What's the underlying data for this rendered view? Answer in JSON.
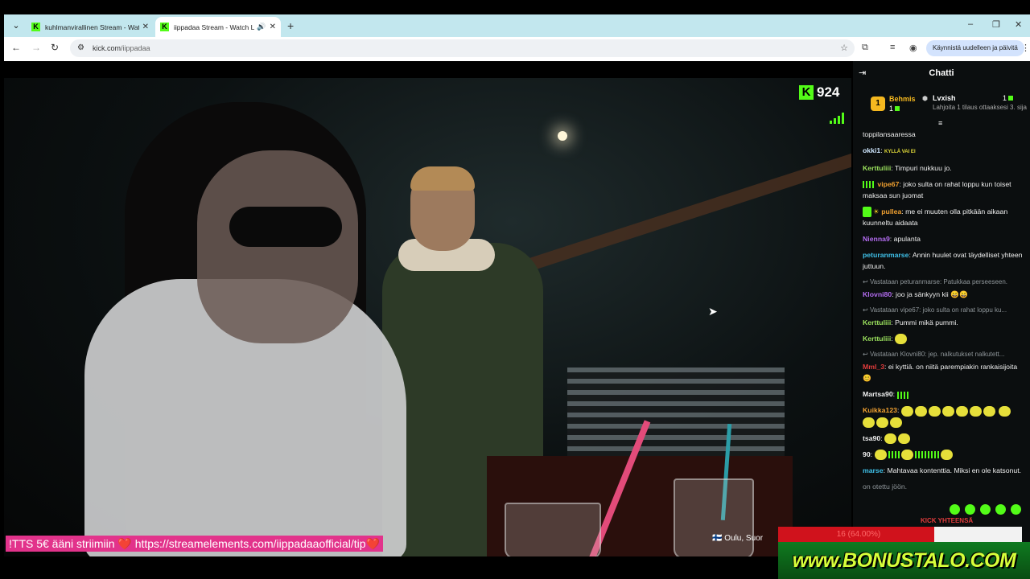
{
  "browser": {
    "tabs": [
      {
        "title": "kuhlmanvirallinen Stream - Wat",
        "active": false
      },
      {
        "title": "iippadaa Stream - Watch Li",
        "active": true
      }
    ],
    "new_tab": "+",
    "url_host": "kick.com",
    "url_path": "/iippadaa",
    "update_button": "Käynnistä uudelleen ja päivitä",
    "window_controls": [
      "–",
      "❐",
      "✕"
    ]
  },
  "stream": {
    "viewer_count": "924",
    "kick_logo": "K",
    "tts_banner": "!TTS 5€ ääni striimiin ❤️ https://streamelements.com/iippadaaofficial/tip❤️",
    "location": "🇫🇮 Oulu, Suor"
  },
  "chat": {
    "header": "Chatti",
    "leaderboard": {
      "first": {
        "rank": "1",
        "name": "Behmis",
        "count": "1"
      },
      "second": {
        "name": "Lvxish",
        "count": "1",
        "note": "Lahjoita 1 tilaus ottaaksesi 3. sija"
      }
    },
    "messages": [
      {
        "user": "",
        "text": "toppilansaaressa",
        "color": "#efefef"
      },
      {
        "user": "okki1",
        "text": "KYLLÄ VAI EI",
        "color": "#cfe7ff"
      },
      {
        "user": "Kerttuliii",
        "text": "Timpuri nukkuu jo.",
        "color": "#9be15d"
      },
      {
        "user": "vipe67",
        "text": "joko sulta on rahat loppu kun toiset maksaa sun juomat",
        "color": "#f0a030"
      },
      {
        "user": "pullea",
        "text": "me ei muuten olla pitkään aikaan kuunneltu aidaata",
        "color": "#f0a030"
      },
      {
        "user": "Nienna9",
        "text": "apulanta",
        "color": "#b36cf0"
      },
      {
        "user": "peturanmarse",
        "text": "Annin huulet ovat täydelliset yhteen juttuun.",
        "color": "#3fc0e8"
      },
      {
        "reply": "Vastataan peturanmarse: Patukkaa perseeseen.",
        "user": "Klovni80",
        "text": "joo ja sänkyyn kii 😄😄",
        "color": "#b36cf0"
      },
      {
        "reply": "Vastataan vipe67: joko sulta on rahat loppu ku...",
        "user": "Kerttuliii",
        "text": "Pummi mikä pummi.",
        "color": "#9be15d"
      },
      {
        "user": "Kerttuliii",
        "text": "",
        "color": "#9be15d"
      },
      {
        "reply": "Vastataan Klovni80: jep. nalkutukset nalkutett...",
        "user": "Mml_3",
        "text": "ei kyttiä. on niitä parempiakin rankaisijoita 😊",
        "color": "#e23c3c"
      },
      {
        "user": "Martsa90",
        "text": "",
        "color": "#efefef"
      },
      {
        "user": "Kuikka123",
        "text": "",
        "color": "#f0a030"
      },
      {
        "user": "tsa90",
        "text": "",
        "color": "#efefef"
      },
      {
        "user": "90",
        "text": "",
        "color": "#efefef"
      },
      {
        "user": "marse",
        "text": "Mahtavaa kontenttia. Miksi en ole katsonut.",
        "color": "#3fc0e8"
      },
      {
        "user": "",
        "text": "on otettu jöön.",
        "color": "#8e9599"
      }
    ],
    "goal_label": "KICK YHTEENSÄ",
    "goal_text": "16 (64.00%)",
    "goal_progress": 0.64
  },
  "banner": {
    "text": "www.BONUSTALO.COM"
  },
  "colors": {
    "kick_green": "#53fc18",
    "tab_strip": "#c2e7ee",
    "tts_pink": "#e2338b",
    "goal_red": "#d0121c"
  }
}
